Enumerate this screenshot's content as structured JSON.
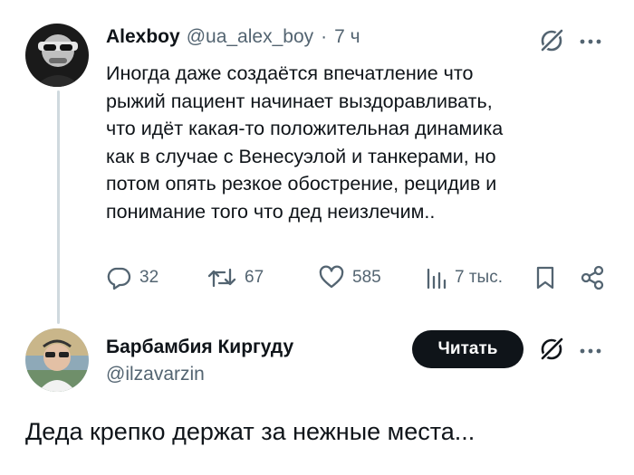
{
  "tweet1": {
    "author_name": "Alexboy",
    "handle": "@ua_alex_boy",
    "separator": "·",
    "time": "7 ч",
    "text_lines": [
      "Иногда даже создаётся впечатление что",
      "рыжий пациент начинает выздоравливать,",
      "что идёт какая-то положительная динамика",
      "как в случае с Венесуэлой и танкерами, но",
      "потом опять резкое обострение, рецидив и",
      "понимание того что дед неизлечим.."
    ],
    "actions": {
      "replies": "32",
      "reposts": "67",
      "likes": "585",
      "views": "7 тыс."
    }
  },
  "tweet2": {
    "author_name": "Барбамбия Киргуду",
    "handle": "@ilzavarzin",
    "follow_label": "Читать",
    "text": "Деда крепко держат за нежные места..."
  },
  "icons": {
    "grok": "grok-slash-icon",
    "more": "more-dots-icon",
    "reply": "reply-bubble-icon",
    "repost": "repost-arrows-icon",
    "like": "heart-icon",
    "views": "views-bars-icon",
    "bookmark": "bookmark-icon",
    "share": "share-icon"
  },
  "colors": {
    "text": "#0f1419",
    "secondary": "#536471",
    "thread_line": "#cfd9de",
    "button_bg": "#0f1419"
  }
}
